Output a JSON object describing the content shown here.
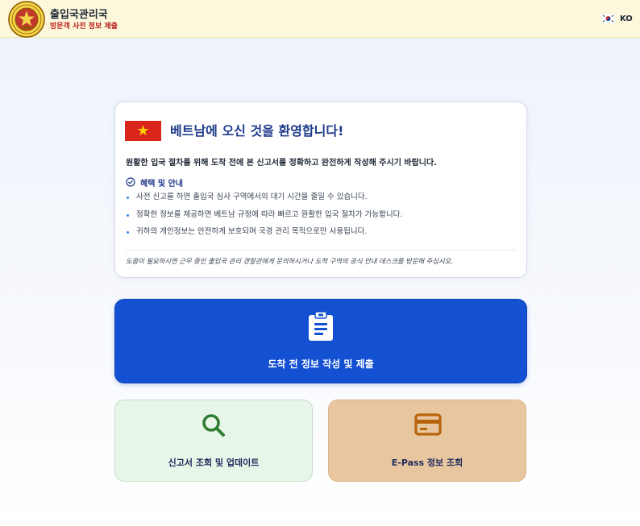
{
  "header": {
    "title": "출입국관리국",
    "subtitle": "방문객 사전 정보 제출",
    "language": "KO"
  },
  "info": {
    "welcome": "베트남에 오신 것을 환영합니다!",
    "intro": "원활한 입국 절차를 위해 도착 전에 본 신고서를 정확하고 완전하게 작성해 주시기 바랍니다.",
    "benefits_title": "혜택 및 안내",
    "benefits": [
      "사전 신고를 하면 출입국 심사 구역에서의 대기 시간을 줄일 수 있습니다.",
      "정확한 정보를 제공하면 베트남 규정에 따라 빠르고 원활한 입국 절차가 가능합니다.",
      "귀하의 개인정보는 안전하게 보호되며 국경 관리 목적으로만 사용됩니다."
    ],
    "help": "도움이 필요하시면 근무 중인 출입국 관리 경찰관에게 문의하시거나 도착 구역의 공식 안내 데스크를 방문해 주십시오."
  },
  "actions": {
    "primary_label": "도착 전 정보 작성 및 제출",
    "lookup_label": "신고서 조회 및 업데이트",
    "epass_label": "E-Pass 정보 조회"
  },
  "icons": {
    "logo": "immigration-emblem-icon",
    "language_flag": "korea-flag-icon",
    "country_flag": "vietnam-flag-icon",
    "benefits": "check-circle-icon",
    "primary": "clipboard-icon",
    "lookup": "search-icon",
    "epass": "credit-card-icon"
  },
  "colors": {
    "header_bg": "#fdf8dc",
    "primary_button": "#1350d2",
    "lookup_card": "#e8f5e9",
    "epass_card": "#e8c7a0",
    "title_blue": "#1e3a8a",
    "subtitle_red": "#b91c1c"
  }
}
